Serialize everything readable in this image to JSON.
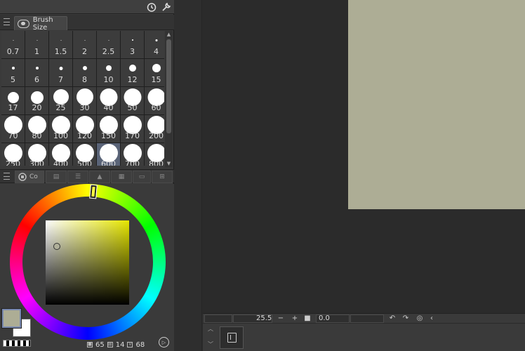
{
  "brush_panel": {
    "tab_label": "Brush Size",
    "sizes": [
      {
        "label": "0.7",
        "d": 1
      },
      {
        "label": "1",
        "d": 1
      },
      {
        "label": "1.5",
        "d": 1
      },
      {
        "label": "2",
        "d": 1
      },
      {
        "label": "2.5",
        "d": 1
      },
      {
        "label": "3",
        "d": 2
      },
      {
        "label": "4",
        "d": 3
      },
      {
        "label": "5",
        "d": 4
      },
      {
        "label": "6",
        "d": 4
      },
      {
        "label": "7",
        "d": 5
      },
      {
        "label": "8",
        "d": 6
      },
      {
        "label": "10",
        "d": 8
      },
      {
        "label": "12",
        "d": 10
      },
      {
        "label": "15",
        "d": 12
      },
      {
        "label": "17",
        "d": 16
      },
      {
        "label": "20",
        "d": 18
      },
      {
        "label": "25",
        "d": 22
      },
      {
        "label": "30",
        "d": 24
      },
      {
        "label": "40",
        "d": 25
      },
      {
        "label": "50",
        "d": 25
      },
      {
        "label": "60",
        "d": 25
      },
      {
        "label": "70",
        "d": 26
      },
      {
        "label": "80",
        "d": 26
      },
      {
        "label": "100",
        "d": 26
      },
      {
        "label": "120",
        "d": 26
      },
      {
        "label": "150",
        "d": 26
      },
      {
        "label": "170",
        "d": 26
      },
      {
        "label": "200",
        "d": 26
      },
      {
        "label": "250",
        "d": 26
      },
      {
        "label": "300",
        "d": 26
      },
      {
        "label": "400",
        "d": 26
      },
      {
        "label": "500",
        "d": 26
      },
      {
        "label": "600",
        "d": 26,
        "selected": true
      },
      {
        "label": "700",
        "d": 26
      },
      {
        "label": "800",
        "d": 26
      }
    ]
  },
  "color_panel": {
    "tab_label": "Co",
    "main_color": "#adad95",
    "sub_color": "#ffffff",
    "hsv": {
      "h": "65",
      "s": "14",
      "v": "68"
    }
  },
  "status_bar": {
    "zoom": "25.5",
    "rotation": "0.0"
  },
  "canvas": {
    "paper_color": "#adad95"
  }
}
